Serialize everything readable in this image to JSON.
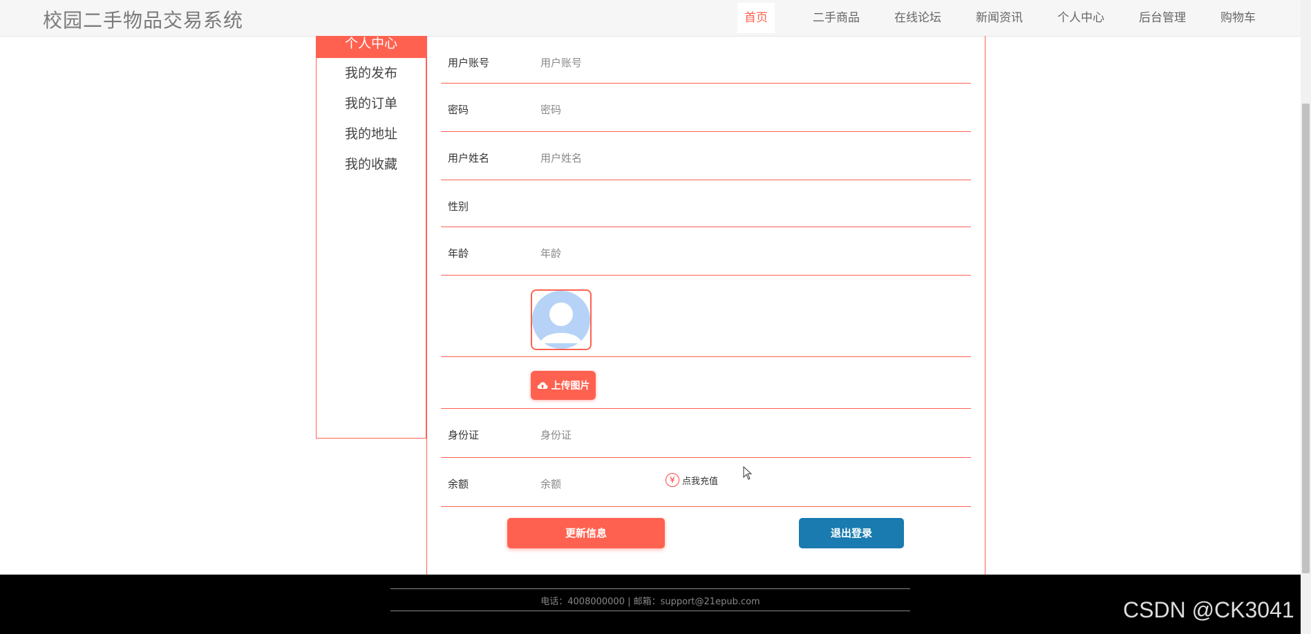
{
  "site": {
    "title": "校园二手物品交易系统"
  },
  "nav": {
    "items": [
      {
        "label": "首页",
        "active": true
      },
      {
        "label": "二手商品"
      },
      {
        "label": "在线论坛"
      },
      {
        "label": "新闻资讯"
      },
      {
        "label": "个人中心"
      },
      {
        "label": "后台管理"
      },
      {
        "label": "购物车"
      }
    ]
  },
  "sidebar": {
    "header": "个人中心",
    "items": [
      "我的发布",
      "我的订单",
      "我的地址",
      "我的收藏"
    ]
  },
  "form": {
    "account": {
      "label": "用户账号",
      "placeholder": "用户账号",
      "value": ""
    },
    "password": {
      "label": "密码",
      "placeholder": "密码",
      "value": ""
    },
    "name": {
      "label": "用户姓名",
      "placeholder": "用户姓名",
      "value": ""
    },
    "gender": {
      "label": "性别",
      "value": ""
    },
    "age": {
      "label": "年龄",
      "placeholder": "年龄",
      "value": ""
    },
    "avatar": {
      "icon": "default-user-avatar-icon"
    },
    "upload": {
      "label": "上传图片",
      "icon": "cloud-upload-icon"
    },
    "idcard": {
      "label": "身份证",
      "placeholder": "身份证",
      "value": ""
    },
    "balance": {
      "label": "余额",
      "placeholder": "余额",
      "value": "",
      "recharge_label": "点我充值",
      "recharge_icon": "yen-icon"
    }
  },
  "actions": {
    "update_label": "更新信息",
    "logout_label": "退出登录"
  },
  "footer": {
    "contact": "电话：4008000000 | 邮箱：support@21epub.com"
  },
  "watermark": "CSDN @CK3041",
  "colors": {
    "accent": "#ff6150",
    "logout": "#1a7bb0",
    "footer_bg": "#000000"
  }
}
